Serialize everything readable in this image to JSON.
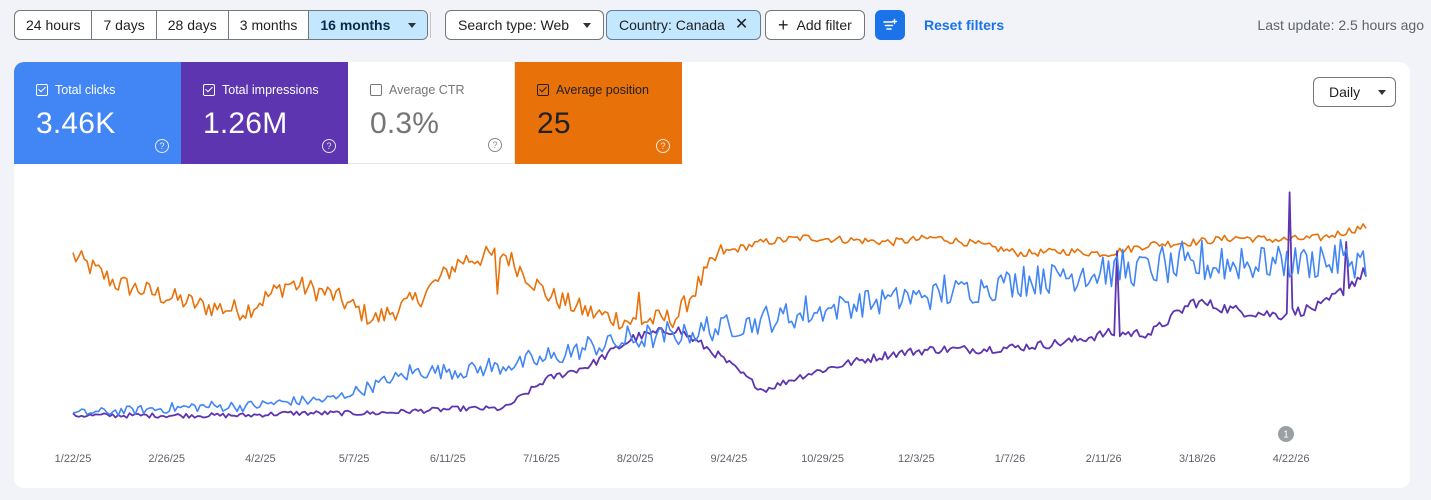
{
  "range_tabs": [
    {
      "label": "24 hours",
      "active": false
    },
    {
      "label": "7 days",
      "active": false
    },
    {
      "label": "28 days",
      "active": false
    },
    {
      "label": "3 months",
      "active": false
    },
    {
      "label": "16 months",
      "active": true
    }
  ],
  "filters": {
    "search_type": "Search type: Web",
    "country": "Country: Canada",
    "add_filter": "Add filter",
    "reset": "Reset filters"
  },
  "last_update": "Last update: 2.5 hours ago",
  "metrics": {
    "clicks": {
      "label": "Total clicks",
      "value": "3.46K",
      "checked": true,
      "color": "#4285f4"
    },
    "impressions": {
      "label": "Total impressions",
      "value": "1.26M",
      "checked": true,
      "color": "#5e35b1"
    },
    "ctr": {
      "label": "Average CTR",
      "value": "0.3%",
      "checked": false
    },
    "position": {
      "label": "Average position",
      "value": "25",
      "checked": true,
      "color": "#e8710a"
    }
  },
  "granularity": "Daily",
  "chart_data": {
    "type": "line",
    "x_tick_labels": [
      "1/22/25",
      "2/26/25",
      "4/2/25",
      "5/7/25",
      "6/11/25",
      "7/16/25",
      "8/20/25",
      "9/24/25",
      "10/29/25",
      "12/3/25",
      "1/7/26",
      "2/11/26",
      "3/18/26",
      "4/22/26"
    ],
    "annotation": {
      "label": "1",
      "near": "4/22/26"
    },
    "axes_values_shown": false,
    "series": [
      {
        "name": "Total clicks",
        "color": "#4285f4",
        "relative_level": [
          0.02,
          0.03,
          0.04,
          0.05,
          0.05,
          0.07,
          0.08,
          0.14,
          0.2,
          0.2,
          0.22,
          0.25,
          0.3,
          0.33,
          0.35,
          0.38,
          0.41,
          0.44,
          0.48,
          0.5,
          0.52,
          0.55,
          0.58,
          0.6,
          0.62,
          0.63,
          0.64,
          0.65,
          0.66,
          0.66,
          0.67
        ]
      },
      {
        "name": "Total impressions",
        "color": "#5e35b1",
        "relative_level": [
          0.02,
          0.02,
          0.02,
          0.02,
          0.02,
          0.03,
          0.03,
          0.03,
          0.04,
          0.05,
          0.05,
          0.18,
          0.24,
          0.36,
          0.4,
          0.28,
          0.13,
          0.2,
          0.25,
          0.29,
          0.31,
          0.31,
          0.32,
          0.34,
          0.38,
          0.38,
          0.52,
          0.48,
          0.46,
          0.5,
          0.65
        ]
      },
      {
        "name": "Average position",
        "color": "#e8710a",
        "relative_level": [
          0.72,
          0.6,
          0.55,
          0.5,
          0.48,
          0.6,
          0.55,
          0.44,
          0.53,
          0.7,
          0.73,
          0.55,
          0.47,
          0.43,
          0.45,
          0.73,
          0.78,
          0.8,
          0.79,
          0.78,
          0.8,
          0.77,
          0.73,
          0.74,
          0.73,
          0.77,
          0.78,
          0.8,
          0.79,
          0.8,
          0.85
        ]
      }
    ]
  }
}
